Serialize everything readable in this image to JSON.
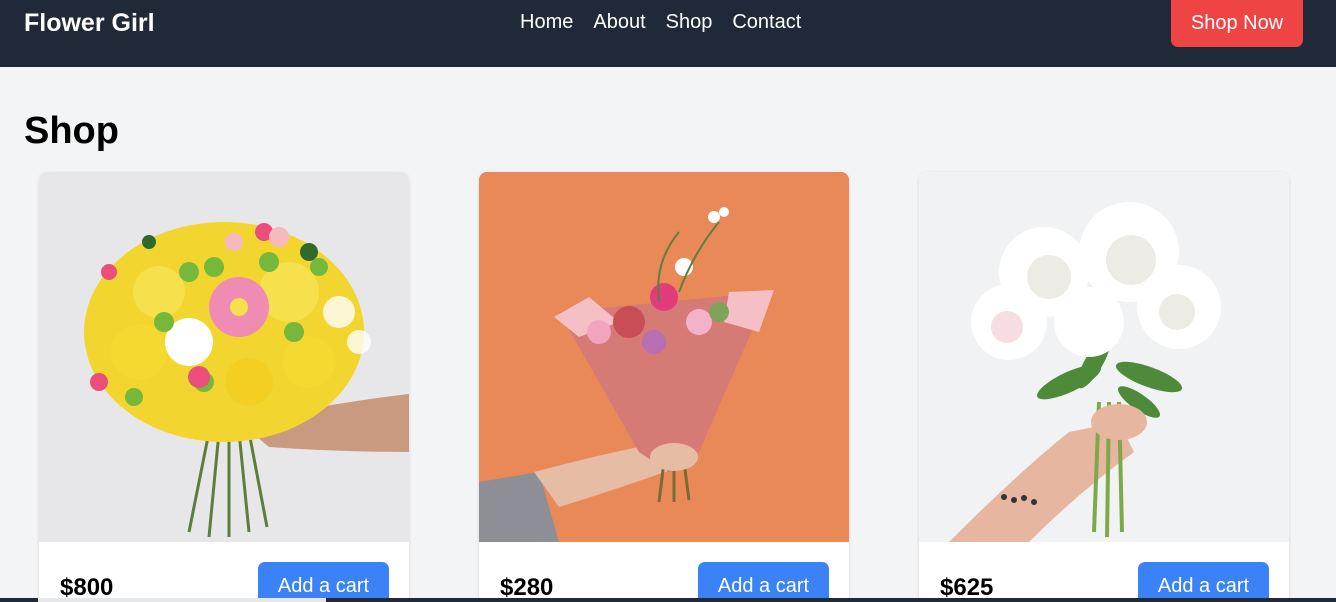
{
  "navbar": {
    "brand": "Flower Girl",
    "links": [
      "Home",
      "About",
      "Shop",
      "Contact"
    ],
    "cta_label": "Shop Now"
  },
  "page": {
    "title": "Shop"
  },
  "products": [
    {
      "price": "$800",
      "button_label": "Add a cart",
      "image": "yellow-pink-bouquet-image"
    },
    {
      "price": "$280",
      "button_label": "Add a cart",
      "image": "pink-wrapped-bouquet-orange-wall-image"
    },
    {
      "price": "$625",
      "button_label": "Add a cart",
      "image": "white-peony-bouquet-image"
    }
  ],
  "colors": {
    "navbar_bg": "#1f2937",
    "page_bg": "#f3f4f6",
    "cta_red": "#ef4444",
    "button_blue": "#3b82f6"
  }
}
